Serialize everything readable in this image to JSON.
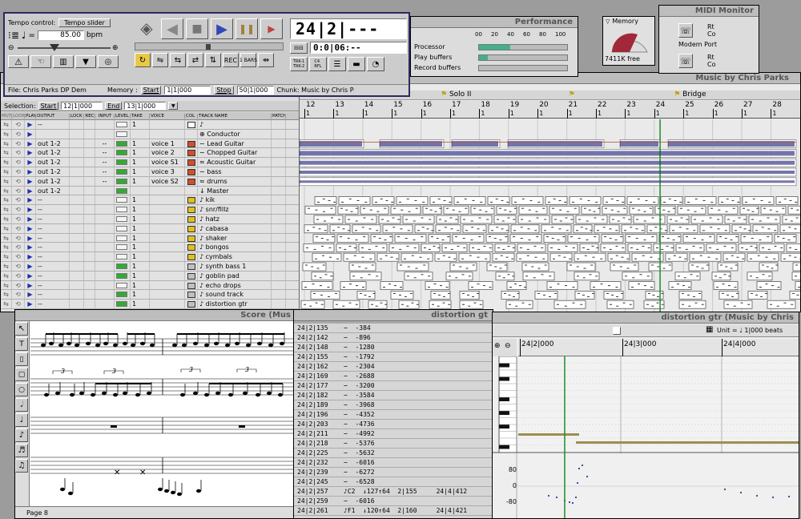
{
  "transport": {
    "tempo_label": "Tempo control:",
    "tempo_mode": "Tempo slider",
    "bpm_value": "85.00",
    "bpm_unit": "bpm",
    "counter_big": "24|2|---",
    "counter_small": "0:0|06:--",
    "file_label": "File: Chris Parks DP Dem",
    "memory_label": "Memory :",
    "start_label": "Start",
    "start_value": "1|1|000",
    "stop_label": "Stop",
    "stop_value": "50|1|000",
    "chunk_label": "Chunk: Music by Chris Par",
    "trk1": "TRK-1\nTRK-2",
    "c4": "C4\nRFL"
  },
  "performance": {
    "title": "Performance",
    "scale": [
      "00",
      "20",
      "40",
      "60",
      "80",
      "100"
    ],
    "rows": [
      {
        "label": "Processor",
        "pct": 35
      },
      {
        "label": "Play buffers",
        "pct": 10
      },
      {
        "label": "Record buffers",
        "pct": 0
      }
    ]
  },
  "memory": {
    "title": "Memory",
    "free": "7411K free"
  },
  "midi_monitor": {
    "title": "MIDI Monitor",
    "ports": [
      {
        "name": "Modem Port",
        "a": "Rt",
        "b": "Co"
      },
      {
        "name": "",
        "a": "Rt",
        "b": "Co"
      }
    ]
  },
  "consolidated": {
    "title": "Music by Chris Parks",
    "selection_label": "Selection:",
    "start_label": "Start",
    "start_value": "12|1|000",
    "end_label": "End",
    "end_value": "13|1|000",
    "columns": [
      "MUTE",
      "LOOP",
      "PLAY",
      "OUTPUT",
      "LOCK",
      "REC",
      "INPUT",
      "LEVEL",
      "TAKE",
      "VOICE",
      "COL",
      "TRACK NAME",
      "PATCH"
    ],
    "tracks": [
      {
        "out": "--",
        "input": "",
        "lvl": false,
        "take": "1",
        "voice": "",
        "color": "#ffffff",
        "name": "♪"
      },
      {
        "out": "",
        "input": "",
        "lvl": false,
        "take": "",
        "voice": "",
        "color": "",
        "name": "⊕ Conductor"
      },
      {
        "out": "out 1-2",
        "input": "--",
        "lvl": true,
        "take": "1",
        "voice": "voice 1",
        "color": "#d0502a",
        "name": "∼ Lead Guitar"
      },
      {
        "out": "out 1-2",
        "input": "--",
        "lvl": true,
        "take": "1",
        "voice": "voice 2",
        "color": "#d0502a",
        "name": "∼ Chopped Guitar"
      },
      {
        "out": "out 1-2",
        "input": "--",
        "lvl": true,
        "take": "1",
        "voice": "voice S1",
        "color": "#d0502a",
        "name": "≈ Acoustic Guitar"
      },
      {
        "out": "out 1-2",
        "input": "--",
        "lvl": true,
        "take": "1",
        "voice": "voice 3",
        "color": "#d0502a",
        "name": "∼ bass"
      },
      {
        "out": "out 1-2",
        "input": "--",
        "lvl": true,
        "take": "1",
        "voice": "voice S2",
        "color": "#d0502a",
        "name": "≈ drums"
      },
      {
        "out": "out 1-2",
        "input": "",
        "lvl": true,
        "take": "",
        "voice": "",
        "color": "",
        "name": "↓ Master"
      },
      {
        "out": "--",
        "input": "",
        "lvl": false,
        "take": "1",
        "voice": "",
        "color": "#e0c020",
        "name": "♪ kik"
      },
      {
        "out": "--",
        "input": "",
        "lvl": false,
        "take": "1",
        "voice": "",
        "color": "#e0c020",
        "name": "♪ snr/fillz"
      },
      {
        "out": "--",
        "input": "",
        "lvl": false,
        "take": "1",
        "voice": "",
        "color": "#e0c020",
        "name": "♪ hatz"
      },
      {
        "out": "--",
        "input": "",
        "lvl": false,
        "take": "1",
        "voice": "",
        "color": "#e0c020",
        "name": "♪ cabasa"
      },
      {
        "out": "--",
        "input": "",
        "lvl": false,
        "take": "1",
        "voice": "",
        "color": "#e0c020",
        "name": "♪ shaker"
      },
      {
        "out": "--",
        "input": "",
        "lvl": false,
        "take": "1",
        "voice": "",
        "color": "#e0c020",
        "name": "♪ bongos"
      },
      {
        "out": "--",
        "input": "",
        "lvl": false,
        "take": "1",
        "voice": "",
        "color": "#e0c020",
        "name": "♪ cymbals"
      },
      {
        "out": "--",
        "input": "",
        "lvl": true,
        "take": "1",
        "voice": "",
        "color": "#c0c0c0",
        "name": "♪ synth bass 1"
      },
      {
        "out": "--",
        "input": "",
        "lvl": true,
        "take": "1",
        "voice": "",
        "color": "#c0c0c0",
        "name": "♪ goblin pad"
      },
      {
        "out": "--",
        "input": "",
        "lvl": false,
        "take": "1",
        "voice": "",
        "color": "#c0c0c0",
        "name": "♪ echo drops"
      },
      {
        "out": "--",
        "input": "",
        "lvl": true,
        "take": "1",
        "voice": "",
        "color": "#c0c0c0",
        "name": "♪ sound track"
      },
      {
        "out": "--",
        "input": "",
        "lvl": true,
        "take": "1",
        "voice": "",
        "color": "#c0c0c0",
        "name": "♪ distortion gtr"
      }
    ],
    "bars": [
      "12",
      "13",
      "14",
      "15",
      "16",
      "17",
      "18",
      "19",
      "20",
      "21",
      "22",
      "23",
      "24",
      "25",
      "26",
      "27",
      "28"
    ],
    "beat": "1",
    "markers": [
      {
        "label": "Solo II",
        "bar": 17
      },
      {
        "label": "Bridge",
        "bar": 25
      }
    ],
    "playhead_bar": 24.2
  },
  "score": {
    "title": "Score (Mus",
    "page": "Page 8",
    "triplet": "3"
  },
  "event_list": {
    "title": "distortion gt",
    "rows": [
      {
        "loc": "24|2|135",
        "val": "∽  -384"
      },
      {
        "loc": "24|2|142",
        "val": "∽  -896"
      },
      {
        "loc": "24|2|148",
        "val": "∽  -1280"
      },
      {
        "loc": "24|2|155",
        "val": "∽  -1792"
      },
      {
        "loc": "24|2|162",
        "val": "∽  -2304"
      },
      {
        "loc": "24|2|169",
        "val": "∽  -2688"
      },
      {
        "loc": "24|2|177",
        "val": "∽  -3200"
      },
      {
        "loc": "24|2|182",
        "val": "∽  -3584"
      },
      {
        "loc": "24|2|189",
        "val": "∽  -3968"
      },
      {
        "loc": "24|2|196",
        "val": "∽  -4352"
      },
      {
        "loc": "24|2|203",
        "val": "∽  -4736"
      },
      {
        "loc": "24|2|211",
        "val": "∽  -4992"
      },
      {
        "loc": "24|2|218",
        "val": "∽  -5376"
      },
      {
        "loc": "24|2|225",
        "val": "∽  -5632"
      },
      {
        "loc": "24|2|232",
        "val": "∽  -6016"
      },
      {
        "loc": "24|2|239",
        "val": "∽  -6272"
      },
      {
        "loc": "24|2|245",
        "val": "∽  -6528"
      },
      {
        "loc": "24|2|257",
        "val": "♪C2  ↓127↑64  2|155     24|4|412"
      },
      {
        "loc": "24|2|259",
        "val": "∽  -6016"
      },
      {
        "loc": "24|2|261",
        "val": "♪F1  ↓120↑64  2|160     24|4|421"
      }
    ]
  },
  "graphic_editor": {
    "title": "distortion gtr (Music by Chris",
    "unit_label": "Unit = ♩ 1|000 beats",
    "ruler": [
      "24|2|000",
      "24|3|000",
      "24|4|000"
    ],
    "velocity_ticks": [
      "80",
      "0",
      "-80"
    ]
  }
}
